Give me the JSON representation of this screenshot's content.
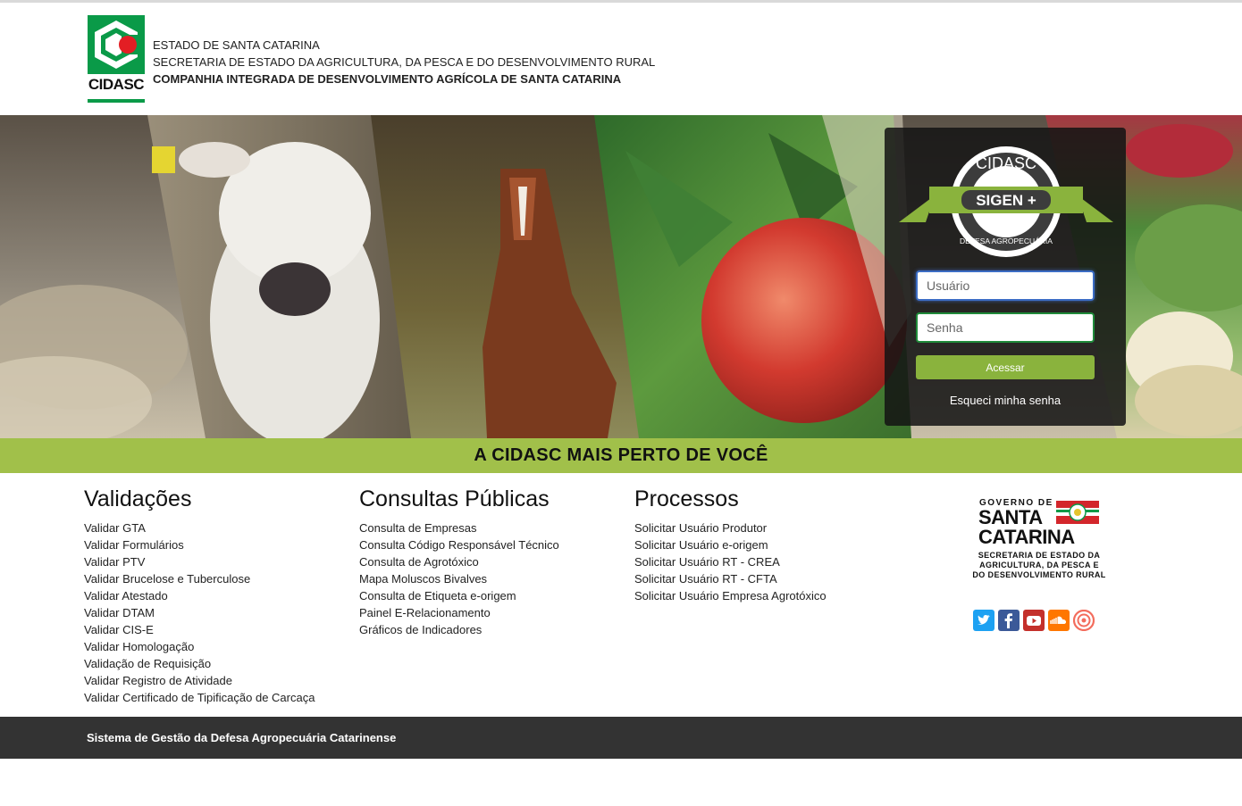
{
  "header": {
    "logo_text": "CIDASC",
    "line1": "ESTADO DE SANTA CATARINA",
    "line2": "SECRETARIA DE ESTADO DA AGRICULTURA, DA PESCA E DO DESENVOLVIMENTO RURAL",
    "line3": "COMPANHIA INTEGRADA DE DESENVOLVIMENTO AGRÍCOLA DE SANTA CATARINA"
  },
  "login": {
    "badge_top": "CIDASC",
    "badge_ribbon": "SIGEN +",
    "badge_bottom": "DEFESA AGROPECUÁRIA",
    "user_placeholder": "Usuário",
    "user_value": "",
    "pass_placeholder": "Senha",
    "pass_value": "",
    "submit_label": "Acessar",
    "forgot_label": "Esqueci minha senha"
  },
  "banner": {
    "text": "A CIDASC MAIS PERTO DE VOCÊ"
  },
  "validacoes": {
    "title": "Validações",
    "items": [
      "Validar GTA",
      "Validar Formulários",
      "Validar PTV",
      "Validar Brucelose e Tuberculose",
      "Validar Atestado",
      "Validar DTAM",
      "Validar CIS-E",
      "Validar Homologação",
      "Validação de Requisição",
      "Validar Registro de Atividade",
      "Validar Certificado de Tipificação de Carcaça"
    ]
  },
  "consultas": {
    "title": "Consultas Públicas",
    "items": [
      "Consulta de Empresas",
      "Consulta Código Responsável Técnico",
      "Consulta de Agrotóxico",
      "Mapa Moluscos Bivalves",
      "Consulta de Etiqueta e-origem",
      "Painel E-Relacionamento",
      "Gráficos de Indicadores"
    ]
  },
  "processos": {
    "title": "Processos",
    "items": [
      "Solicitar Usuário Produtor",
      "Solicitar Usuário e-origem",
      "Solicitar Usuário RT - CREA",
      "Solicitar Usuário RT - CFTA",
      "Solicitar Usuário Empresa Agrotóxico"
    ]
  },
  "gov_logo": {
    "line1": "GOVERNO DE",
    "line2a": "SANTA",
    "line2b": "CATARINA",
    "line3": "SECRETARIA DE ESTADO DA",
    "line4": "AGRICULTURA, DA PESCA E",
    "line5": "DO DESENVOLVIMENTO RURAL"
  },
  "social": [
    {
      "icon": "twitter-icon",
      "color": "#1da1f2"
    },
    {
      "icon": "facebook-icon",
      "color": "#3b5998"
    },
    {
      "icon": "youtube-icon",
      "color": "#c4302b"
    },
    {
      "icon": "soundcloud-icon",
      "color": "#ff7700"
    },
    {
      "icon": "issuu-icon",
      "color": "#f36d5d"
    }
  ],
  "footer": {
    "text": "Sistema de Gestão da Defesa Agropecuária Catarinense"
  },
  "colors": {
    "brand_green": "#0a9a48",
    "banner_green": "#a1c04a",
    "button_green": "#8ab33d",
    "footer_bg": "#333333"
  }
}
